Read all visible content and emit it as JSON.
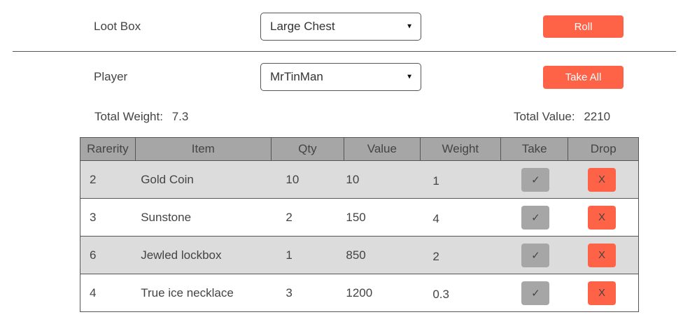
{
  "loot_box": {
    "label": "Loot Box",
    "selected": "Large Chest",
    "action": "Roll"
  },
  "player": {
    "label": "Player",
    "selected": "MrTinMan",
    "action": "Take All"
  },
  "totals": {
    "weight_label": "Total Weight:",
    "weight_value": "7.3",
    "value_label": "Total Value:",
    "value_value": "2210"
  },
  "table": {
    "headers": {
      "rarity": "Rarerity",
      "item": "Item",
      "qty": "Qty",
      "value": "Value",
      "weight": "Weight",
      "take": "Take",
      "drop": "Drop"
    },
    "rows": [
      {
        "rarity": "2",
        "item": "Gold Coin",
        "qty": "10",
        "value": "10",
        "weight": "1",
        "take": "✓",
        "drop": "X"
      },
      {
        "rarity": "3",
        "item": "Sunstone",
        "qty": "2",
        "value": "150",
        "weight": "4",
        "take": "✓",
        "drop": "X"
      },
      {
        "rarity": "6",
        "item": "Jewled lockbox",
        "qty": "1",
        "value": "850",
        "weight": "2",
        "take": "✓",
        "drop": "X"
      },
      {
        "rarity": "4",
        "item": "True ice necklace",
        "qty": "3",
        "value": "1200",
        "weight": "0.3",
        "take": "✓",
        "drop": "X"
      }
    ]
  },
  "colors": {
    "accent": "#ff6347",
    "header_bg": "#a6a6a6",
    "row_shade": "#dcdcdc"
  }
}
